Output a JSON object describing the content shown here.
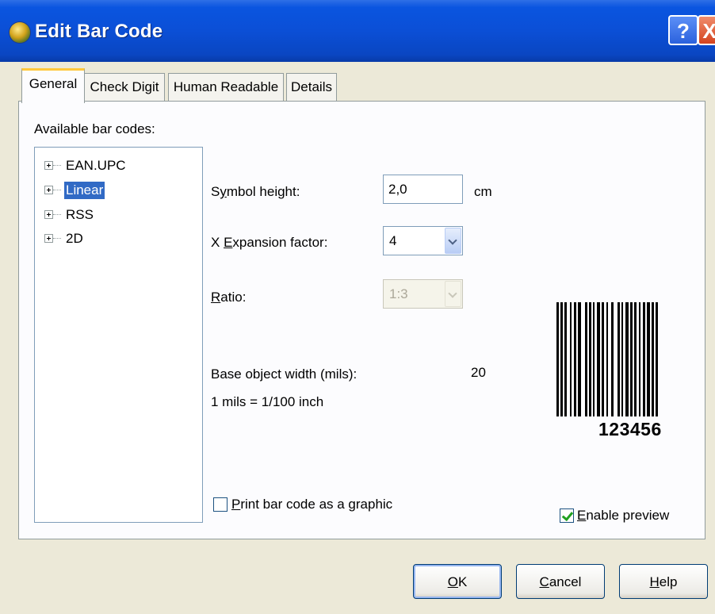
{
  "window": {
    "title": "Edit Bar Code",
    "help_btn": "?",
    "close_btn": "X"
  },
  "tabs": [
    {
      "label": "General",
      "active": true
    },
    {
      "label": "Check Digit",
      "active": false
    },
    {
      "label": "Human Readable",
      "active": false
    },
    {
      "label": "Details",
      "active": false
    }
  ],
  "general": {
    "available_label": "Available bar codes:",
    "tree": [
      {
        "label": "EAN.UPC",
        "selected": false
      },
      {
        "label": "Linear",
        "selected": true
      },
      {
        "label": "RSS",
        "selected": false
      },
      {
        "label": "2D",
        "selected": false
      }
    ],
    "symbol_height": {
      "label_pre": "S",
      "label_u": "y",
      "label_post": "mbol height:",
      "value": "2,0",
      "unit": "cm"
    },
    "x_expansion": {
      "label_pre": "X ",
      "label_u": "E",
      "label_post": "xpansion factor:",
      "value": "4"
    },
    "ratio": {
      "label_u": "R",
      "label_post": "atio:",
      "value": "1:3",
      "disabled": true
    },
    "base_width": {
      "label": "Base object width (mils):",
      "value": "20"
    },
    "mils_note": "1 mils = 1/100 inch",
    "print_graphic": {
      "label_u": "P",
      "label_post": "rint bar code as a graphic",
      "checked": false
    },
    "preview": {
      "number": "123456"
    },
    "enable_preview": {
      "label_u": "E",
      "label_post": "nable preview",
      "checked": true
    }
  },
  "buttons": {
    "ok": {
      "u": "O",
      "rest": "K"
    },
    "cancel": {
      "u": "C",
      "rest": "ancel"
    },
    "help": {
      "u": "H",
      "rest": "elp"
    }
  },
  "colors": {
    "titlebar": "#0a4fd6",
    "selection": "#316ac5",
    "tab_highlight": "#ffc83c",
    "dialog_bg": "#ece9d8",
    "check": "#21a121"
  },
  "icons": [
    "app-icon",
    "help-icon",
    "close-icon",
    "expand-plus-icon",
    "dropdown-arrow-icon",
    "checkmark-icon"
  ]
}
